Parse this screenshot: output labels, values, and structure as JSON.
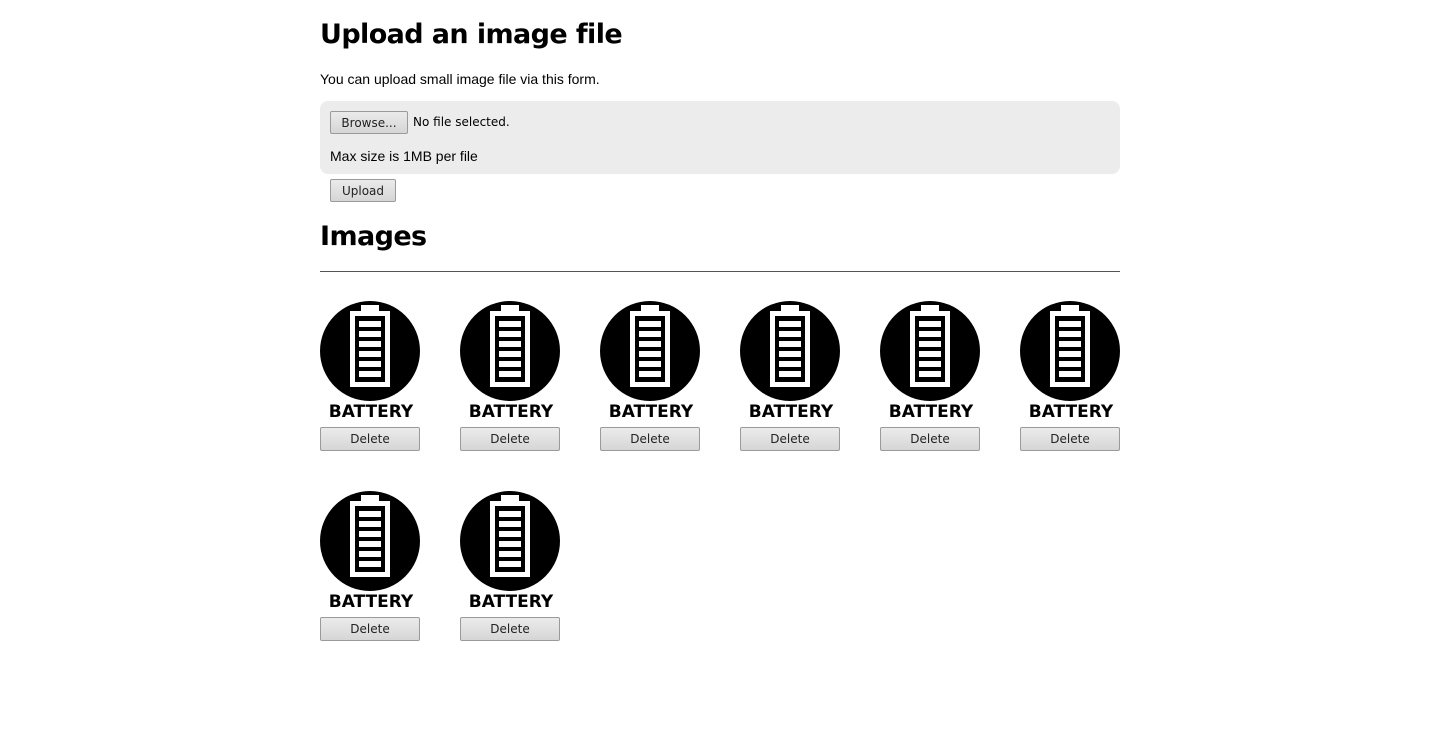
{
  "upload": {
    "title": "Upload an image file",
    "intro": "You can upload small image file via this form.",
    "browse_label": "Browse...",
    "file_status": "No file selected.",
    "max_size": "Max size is 1MB per file",
    "upload_label": "Upload"
  },
  "images": {
    "title": "Images",
    "items": [
      {
        "caption": "BATTERY",
        "delete_label": "Delete"
      },
      {
        "caption": "BATTERY",
        "delete_label": "Delete"
      },
      {
        "caption": "BATTERY",
        "delete_label": "Delete"
      },
      {
        "caption": "BATTERY",
        "delete_label": "Delete"
      },
      {
        "caption": "BATTERY",
        "delete_label": "Delete"
      },
      {
        "caption": "BATTERY",
        "delete_label": "Delete"
      },
      {
        "caption": "BATTERY",
        "delete_label": "Delete"
      },
      {
        "caption": "BATTERY",
        "delete_label": "Delete"
      }
    ]
  },
  "icon": "battery-icon"
}
